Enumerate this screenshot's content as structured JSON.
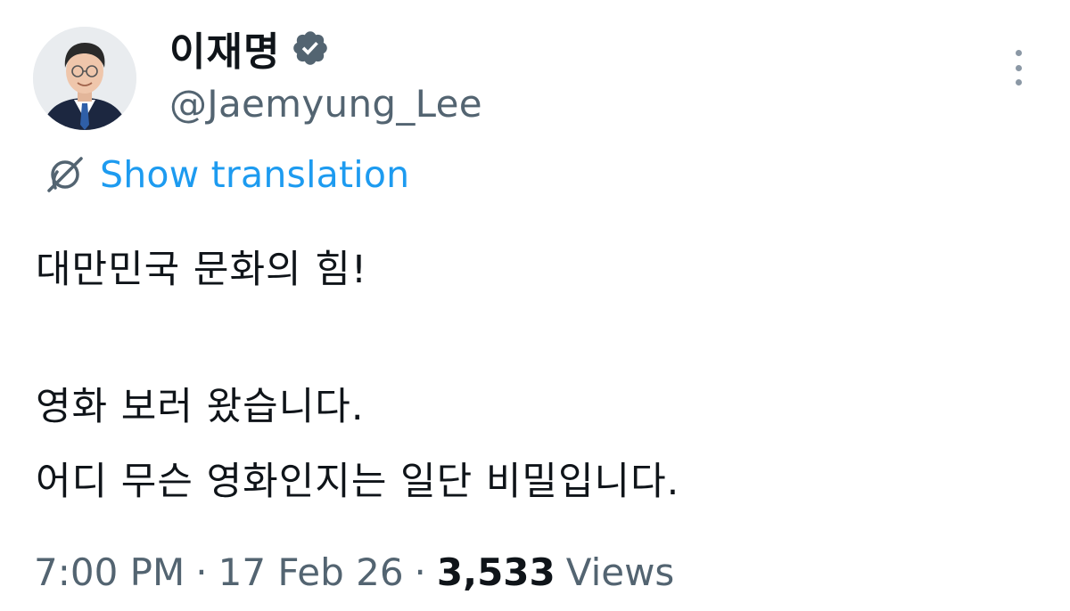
{
  "author": {
    "display_name": "이재명",
    "handle": "@Jaemyung_Lee",
    "avatar_icon": "profile-photo",
    "verified_icon": "verified-badge-icon",
    "verified_color": "#536471"
  },
  "actions": {
    "more_icon": "more-vertical-icon",
    "translate_icon": "translate-globe-icon",
    "translate_label": "Show translation"
  },
  "tweet": {
    "lines": [
      "대만민국 문화의 힘!",
      "영화 보러 왔습니다.",
      "어디 무슨 영화인지는 일단 비밀입니다."
    ]
  },
  "meta": {
    "time": "7:00 PM",
    "separator": "·",
    "date": "17 Feb 26",
    "views_count": "3,533",
    "views_label": "Views"
  },
  "colors": {
    "link": "#1d9bf0",
    "secondary_text": "#536471",
    "primary_text": "#0f1419"
  }
}
